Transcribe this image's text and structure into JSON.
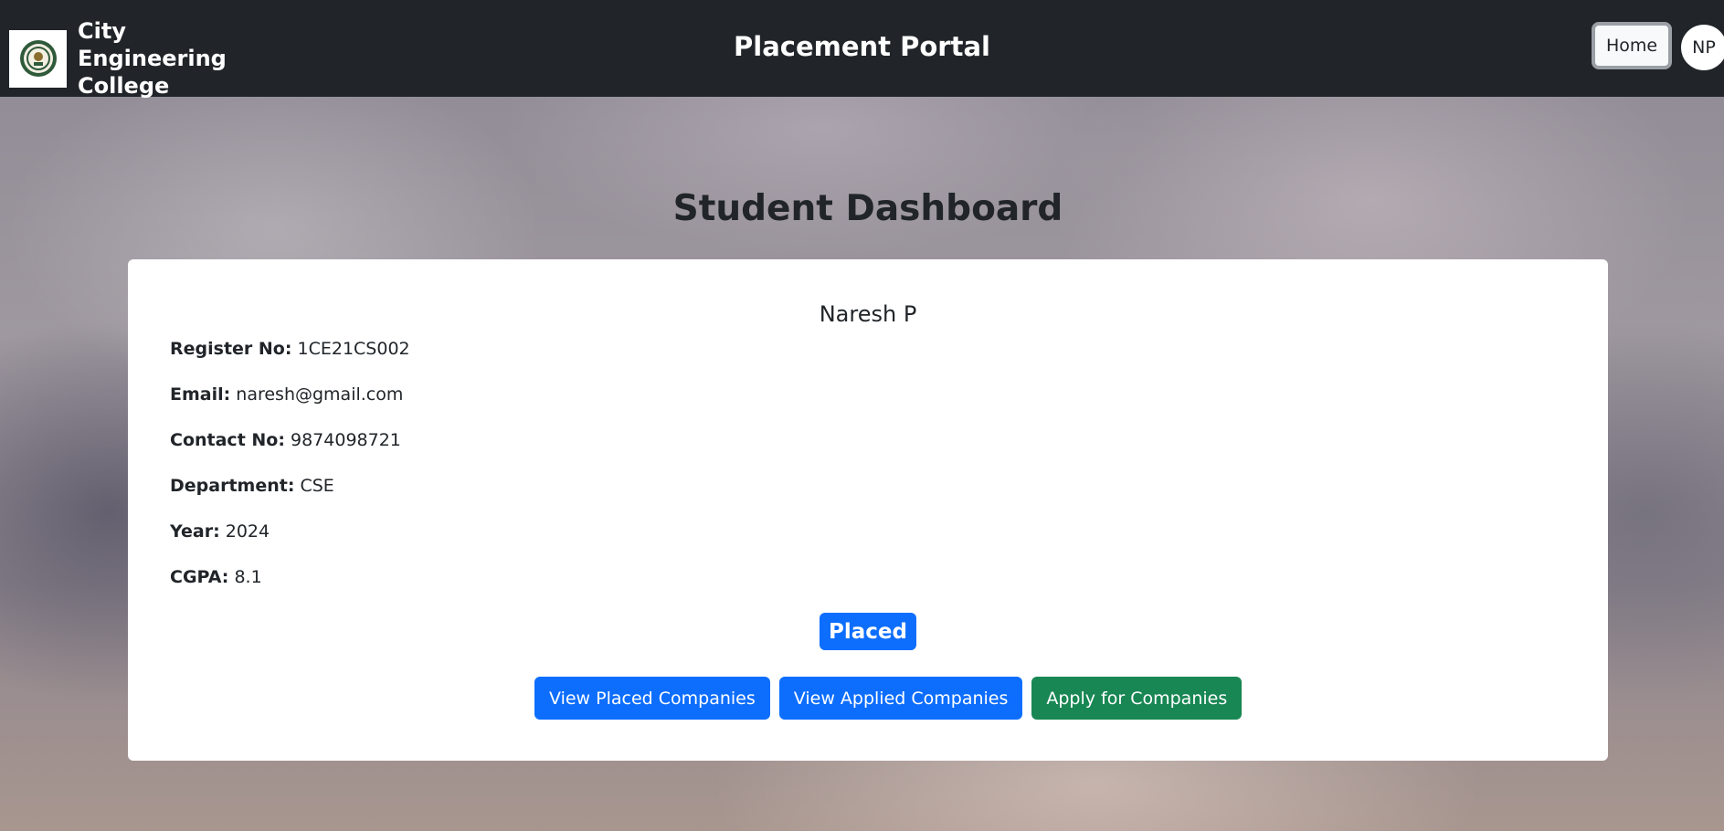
{
  "navbar": {
    "college_name": "City Engineering College",
    "portal_title": "Placement Portal",
    "home_label": "Home",
    "avatar_initials": "NP"
  },
  "page": {
    "heading": "Student Dashboard"
  },
  "student": {
    "name": "Naresh P",
    "fields": [
      {
        "label": "Register No:",
        "value": "1CE21CS002"
      },
      {
        "label": "Email:",
        "value": "naresh@gmail.com"
      },
      {
        "label": "Contact No:",
        "value": "9874098721"
      },
      {
        "label": "Department:",
        "value": "CSE"
      },
      {
        "label": "Year:",
        "value": "2024"
      },
      {
        "label": "CGPA:",
        "value": "8.1"
      }
    ],
    "status": "Placed"
  },
  "actions": {
    "view_placed": "View Placed Companies",
    "view_applied": "View Applied Companies",
    "apply": "Apply for Companies"
  },
  "colors": {
    "navbar_bg": "#212529",
    "primary": "#0d6efd",
    "success": "#198754"
  }
}
